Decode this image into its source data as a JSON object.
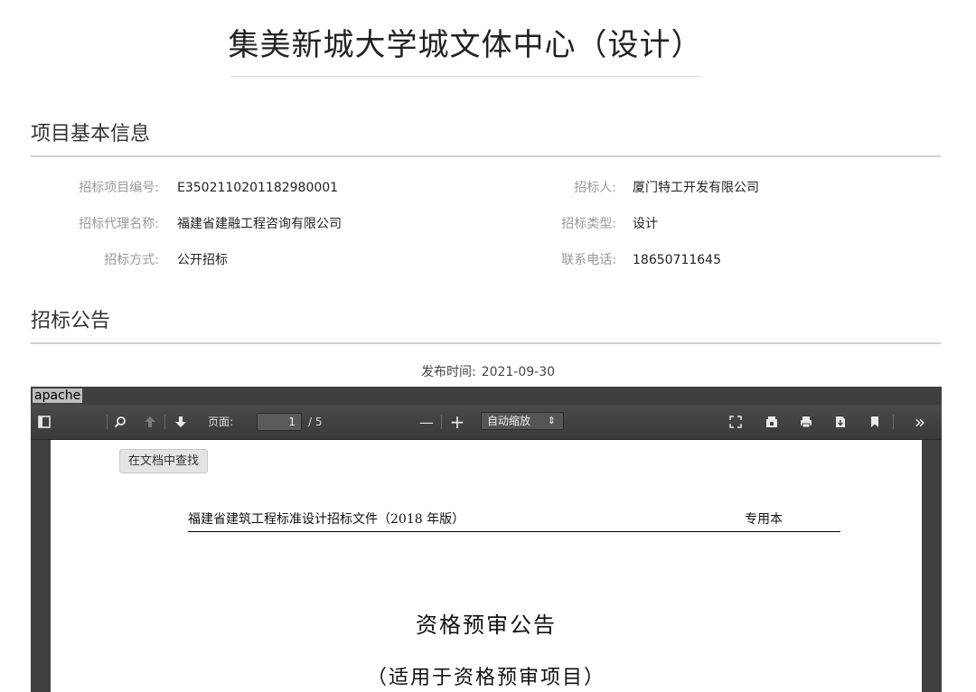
{
  "page_title": "集美新城大学城文体中心（设计）",
  "project_section": {
    "heading": "项目基本信息",
    "fields": [
      {
        "label": "招标项目编号:",
        "value": "E3502110201182980001"
      },
      {
        "label": "招标人:",
        "value": "厦门特工开发有限公司"
      },
      {
        "label": "招标代理名称:",
        "value": "福建省建融工程咨询有限公司"
      },
      {
        "label": "招标类型:",
        "value": "设计"
      },
      {
        "label": "招标方式:",
        "value": "公开招标"
      },
      {
        "label": "联系电话:",
        "value": "18650711645"
      }
    ]
  },
  "notice_section": {
    "heading": "招标公告",
    "publish_label": "发布时间:",
    "publish_date": "2021-09-30"
  },
  "viewer": {
    "alt_text": "apache",
    "toolbar": {
      "page_label": "页面:",
      "current_page": "1",
      "page_count": "/ 5",
      "zoom_minus": "—",
      "zoom_plus": "+",
      "zoom_value": "自动缩放",
      "more": "»"
    },
    "find_tooltip": "在文档中查找",
    "document": {
      "header_left": "福建省建筑工程标准设计招标文件（2018 年版）",
      "header_right": "专用本",
      "title": "资格预审公告",
      "subtitle": "（适用于资格预审项目）"
    }
  }
}
